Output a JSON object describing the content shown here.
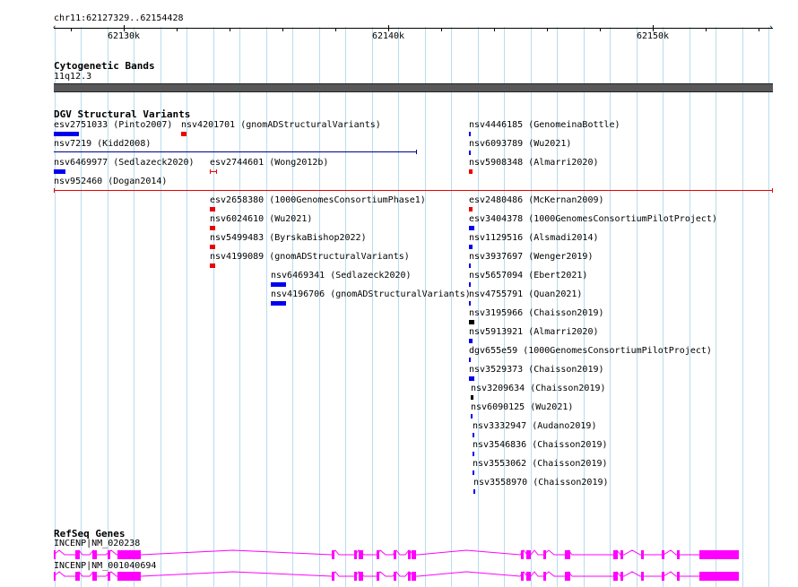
{
  "ruler": {
    "locus": "chr11:62127329..62154428",
    "ticks": [
      "62130k",
      "62140k",
      "62150k"
    ]
  },
  "tracks": {
    "cytoband": {
      "title": "Cytogenetic Bands",
      "band": "11q12.3"
    },
    "dgv": {
      "title": "DGV Structural Variants",
      "features": [
        {
          "label": "esv2751033 (Pinto2007)",
          "color": "#0000ee"
        },
        {
          "label": "nsv4201701 (gnomADStructuralVariants)",
          "color": "#ee0000"
        },
        {
          "label": "nsv4446185 (GenomeinaBottle)",
          "color": "#0000ee"
        },
        {
          "label": "nsv7219 (Kidd2008)",
          "color": "#000088"
        },
        {
          "label": "nsv6093789 (Wu2021)",
          "color": "#0000ee"
        },
        {
          "label": "nsv6469977 (Sedlazeck2020)",
          "color": "#0000ee"
        },
        {
          "label": "esv2744601 (Wong2012b)",
          "color": "#ee0000"
        },
        {
          "label": "nsv5908348 (Almarri2020)",
          "color": "#ee0000"
        },
        {
          "label": "nsv952460 (Dogan2014)",
          "color": "#ee0000"
        },
        {
          "label": "esv2658380 (1000GenomesConsortiumPhase1)",
          "color": "#ee0000"
        },
        {
          "label": "esv2480486 (McKernan2009)",
          "color": "#ee0000"
        },
        {
          "label": "nsv6024610 (Wu2021)",
          "color": "#ee0000"
        },
        {
          "label": "esv3404378 (1000GenomesConsortiumPilotProject)",
          "color": "#0000ee"
        },
        {
          "label": "nsv5499483 (ByrskaBishop2022)",
          "color": "#ee0000"
        },
        {
          "label": "nsv1129516 (Alsmadi2014)",
          "color": "#0000ee"
        },
        {
          "label": "nsv4199089 (gnomADStructuralVariants)",
          "color": "#ee0000"
        },
        {
          "label": "nsv3937697 (Wenger2019)",
          "color": "#0000ee"
        },
        {
          "label": "nsv6469341 (Sedlazeck2020)",
          "color": "#0000ee"
        },
        {
          "label": "nsv5657094 (Ebert2021)",
          "color": "#0000ee"
        },
        {
          "label": "nsv4196706 (gnomADStructuralVariants)",
          "color": "#0000ee"
        },
        {
          "label": "nsv4755791 (Quan2021)",
          "color": "#0000ee"
        },
        {
          "label": "nsv3195966 (Chaisson2019)",
          "color": "#000000"
        },
        {
          "label": "nsv5913921 (Almarri2020)",
          "color": "#0000ee"
        },
        {
          "label": "dgv655e59 (1000GenomesConsortiumPilotProject)",
          "color": "#0000ee"
        },
        {
          "label": "nsv3529373 (Chaisson2019)",
          "color": "#0000ee"
        },
        {
          "label": "nsv3209634 (Chaisson2019)",
          "color": "#000000"
        },
        {
          "label": "nsv6090125 (Wu2021)",
          "color": "#0000ee"
        },
        {
          "label": "nsv3332947 (Audano2019)",
          "color": "#0000ee"
        },
        {
          "label": "nsv3546836 (Chaisson2019)",
          "color": "#0000ee"
        },
        {
          "label": "nsv3553062 (Chaisson2019)",
          "color": "#0000ee"
        },
        {
          "label": "nsv3558970 (Chaisson2019)",
          "color": "#0000ee"
        }
      ]
    },
    "refseq": {
      "title": "RefSeq Genes",
      "color": "#ff00ff",
      "transcripts": [
        {
          "label": "INCENP|NM_020238"
        },
        {
          "label": "INCENP|NM_001040694"
        }
      ]
    }
  }
}
